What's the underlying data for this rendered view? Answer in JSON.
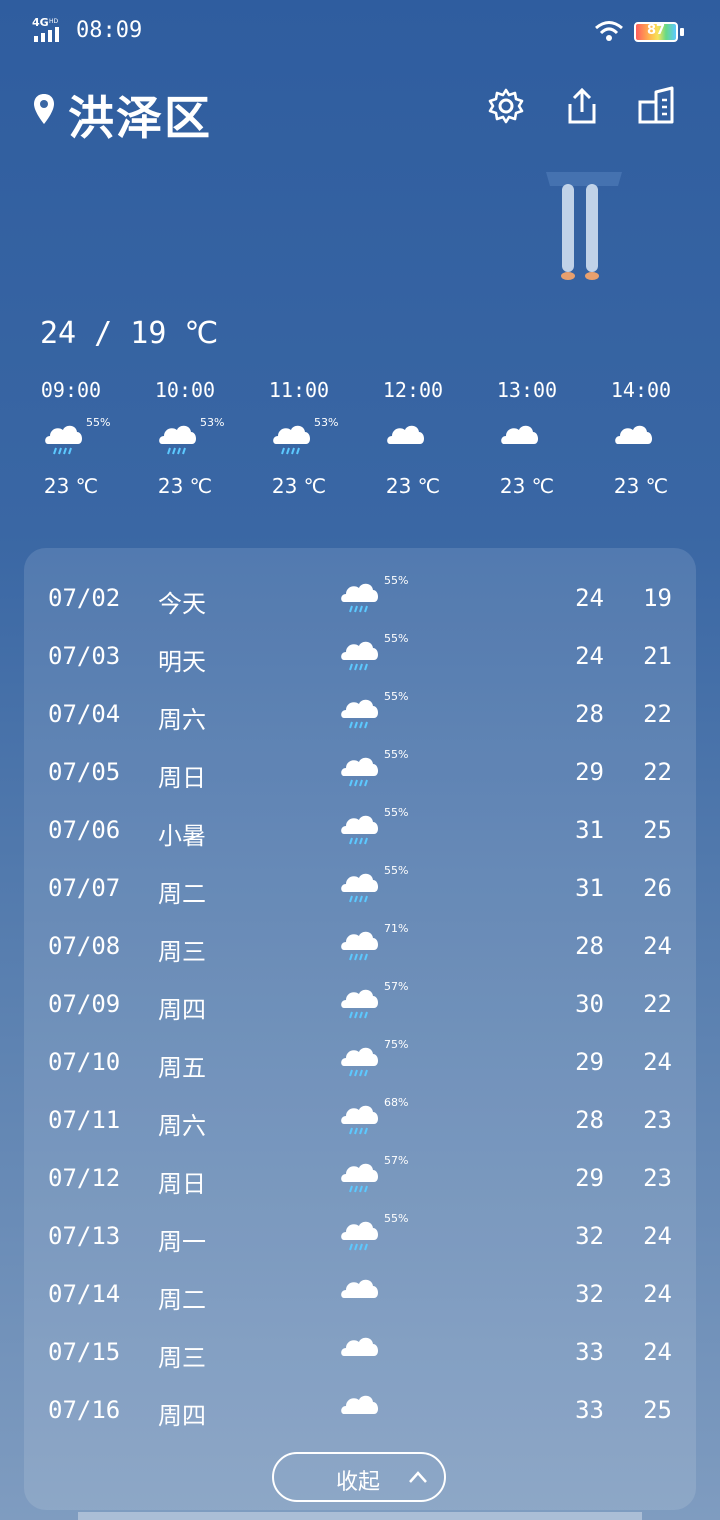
{
  "status_bar": {
    "network": "4G HD",
    "time": "08:09",
    "battery": "87"
  },
  "header": {
    "city": "洪泽区",
    "icons": [
      "pin-icon",
      "settings-icon",
      "share-icon",
      "manage-city-icon"
    ]
  },
  "today": {
    "range": "24 / 19 ℃"
  },
  "hourly": [
    {
      "time": "09:00",
      "icon": "rain-cloud",
      "pct": "55%",
      "temp": "23 ℃"
    },
    {
      "time": "10:00",
      "icon": "rain-cloud",
      "pct": "53%",
      "temp": "23 ℃"
    },
    {
      "time": "11:00",
      "icon": "rain-cloud",
      "pct": "53%",
      "temp": "23 ℃"
    },
    {
      "time": "12:00",
      "icon": "cloud",
      "pct": "",
      "temp": "23 ℃"
    },
    {
      "time": "13:00",
      "icon": "cloud",
      "pct": "",
      "temp": "23 ℃"
    },
    {
      "time": "14:00",
      "icon": "cloud",
      "pct": "",
      "temp": "23 ℃"
    }
  ],
  "daily": [
    {
      "date": "07/02",
      "label": "今天",
      "icon": "rain-cloud",
      "pct": "55%",
      "high": "24",
      "low": "19"
    },
    {
      "date": "07/03",
      "label": "明天",
      "icon": "rain-cloud",
      "pct": "55%",
      "high": "24",
      "low": "21"
    },
    {
      "date": "07/04",
      "label": "周六",
      "icon": "rain-cloud",
      "pct": "55%",
      "high": "28",
      "low": "22"
    },
    {
      "date": "07/05",
      "label": "周日",
      "icon": "rain-cloud",
      "pct": "55%",
      "high": "29",
      "low": "22"
    },
    {
      "date": "07/06",
      "label": "小暑",
      "icon": "rain-cloud",
      "pct": "55%",
      "high": "31",
      "low": "25"
    },
    {
      "date": "07/07",
      "label": "周二",
      "icon": "rain-cloud",
      "pct": "55%",
      "high": "31",
      "low": "26"
    },
    {
      "date": "07/08",
      "label": "周三",
      "icon": "rain-cloud",
      "pct": "71%",
      "high": "28",
      "low": "24"
    },
    {
      "date": "07/09",
      "label": "周四",
      "icon": "rain-cloud",
      "pct": "57%",
      "high": "30",
      "low": "22"
    },
    {
      "date": "07/10",
      "label": "周五",
      "icon": "rain-cloud",
      "pct": "75%",
      "high": "29",
      "low": "24"
    },
    {
      "date": "07/11",
      "label": "周六",
      "icon": "rain-cloud",
      "pct": "68%",
      "high": "28",
      "low": "23"
    },
    {
      "date": "07/12",
      "label": "周日",
      "icon": "rain-cloud",
      "pct": "57%",
      "high": "29",
      "low": "23"
    },
    {
      "date": "07/13",
      "label": "周一",
      "icon": "rain-cloud",
      "pct": "55%",
      "high": "32",
      "low": "24"
    },
    {
      "date": "07/14",
      "label": "周二",
      "icon": "cloud",
      "pct": "",
      "high": "32",
      "low": "24"
    },
    {
      "date": "07/15",
      "label": "周三",
      "icon": "cloud",
      "pct": "",
      "high": "33",
      "low": "24"
    },
    {
      "date": "07/16",
      "label": "周四",
      "icon": "cloud",
      "pct": "",
      "high": "33",
      "low": "25"
    }
  ],
  "collapse_button": {
    "label": "收起"
  },
  "colors": {
    "background_top": "#2f5d9f",
    "background_bottom": "#7f9cc0",
    "rain": "#5cc9ff"
  }
}
